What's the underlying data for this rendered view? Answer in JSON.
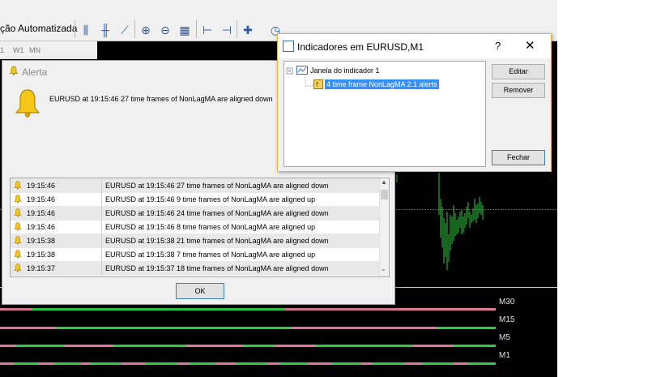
{
  "toolbar": {
    "title_fragment": "ção Automatizada",
    "timeframes": [
      "1",
      "W1",
      "MN"
    ]
  },
  "alert": {
    "title": "Alerta",
    "message": "EURUSD at 19:15:46 27 time frames of NonLagMA are aligned down",
    "rows": [
      {
        "time": "19:15:46",
        "text": "EURUSD at 19:15:46 27 time frames of NonLagMA are aligned down"
      },
      {
        "time": "19:15:46",
        "text": "EURUSD at 19:15:46 9 time frames of NonLagMA are aligned up"
      },
      {
        "time": "19:15:46",
        "text": "EURUSD at 19:15:46 24 time frames of NonLagMA are aligned down"
      },
      {
        "time": "19:15:46",
        "text": "EURUSD at 19:15:46 8 time frames of NonLagMA are aligned up"
      },
      {
        "time": "19:15:38",
        "text": "EURUSD at 19:15:38 21 time frames of NonLagMA are aligned down"
      },
      {
        "time": "19:15:38",
        "text": "EURUSD at 19:15:38 7 time frames of NonLagMA are aligned up"
      },
      {
        "time": "19:15:37",
        "text": "EURUSD at 19:15:37 18 time frames of NonLagMA are aligned down"
      }
    ],
    "ok_label": "OK"
  },
  "indicators": {
    "title": "Indicadores em EURUSD,M1",
    "help": "?",
    "close": "✕",
    "tree": {
      "window": "Janela do indicador 1",
      "item": "4 time frame NonLagMA 2.1 alerts"
    },
    "buttons": {
      "edit": "Editar",
      "remove": "Remover",
      "close": "Fechar"
    }
  },
  "panel": {
    "labels": [
      "M30",
      "M15",
      "M5",
      "M1"
    ]
  },
  "colors": {
    "up": "#2ecc40",
    "down": "#e0789a"
  }
}
